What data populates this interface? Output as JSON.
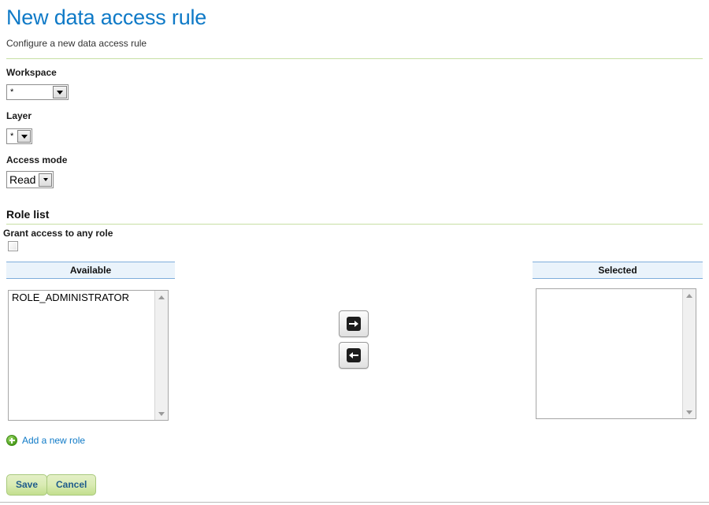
{
  "header": {
    "title": "New data access rule",
    "subtitle": "Configure a new data access rule"
  },
  "form": {
    "workspace": {
      "label": "Workspace",
      "value": "*"
    },
    "layer": {
      "label": "Layer",
      "value": "*"
    },
    "access_mode": {
      "label": "Access mode",
      "value": "Read"
    }
  },
  "role_list": {
    "heading": "Role list",
    "grant_any_label": "Grant access to any role",
    "grant_any_checked": false,
    "available": {
      "header": "Available",
      "options": [
        "ROLE_ADMINISTRATOR"
      ]
    },
    "selected": {
      "header": "Selected",
      "options": []
    },
    "transfer": {
      "add_icon": "arrow-right-icon",
      "remove_icon": "arrow-left-icon"
    },
    "add_role_link": {
      "icon": "plus-circle-icon",
      "label": "Add a new role"
    }
  },
  "actions": {
    "save_label": "Save",
    "cancel_label": "Cancel"
  },
  "colors": {
    "title_blue": "#0F7AC7",
    "rule_green": "#C7DFA4",
    "column_header_bg": "#EAF3FB",
    "column_header_border": "#7FAEDB",
    "button_green_top": "#E4F0C7",
    "button_green_bottom": "#C3DF8E",
    "button_text_blue": "#1F5C8B",
    "link_blue": "#0F7AC7",
    "plus_green": "#4FA01F"
  }
}
